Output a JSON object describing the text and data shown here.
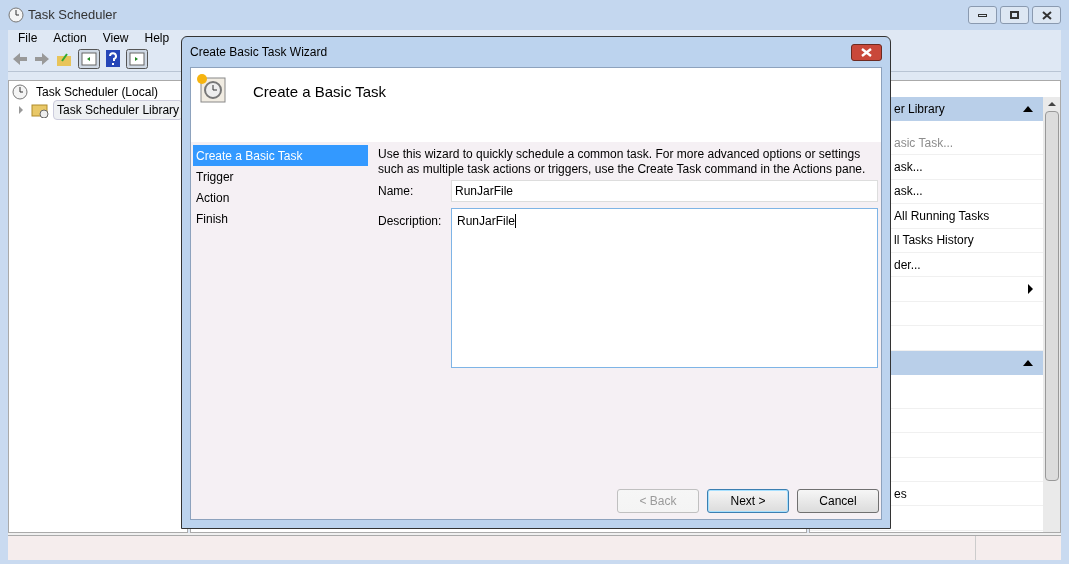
{
  "window": {
    "title": "Task Scheduler"
  },
  "menu": [
    "File",
    "Action",
    "View",
    "Help"
  ],
  "tree": [
    {
      "label": "Task Scheduler (Local)",
      "kind": "root",
      "selected": false
    },
    {
      "label": "Task Scheduler Library",
      "kind": "folder",
      "selected": true
    }
  ],
  "actions_pane": [
    {
      "kind": "header",
      "label": "er Library"
    },
    {
      "kind": "item",
      "label": "asic Task...",
      "disabled": true
    },
    {
      "kind": "item",
      "label": "ask...",
      "disabled": false
    },
    {
      "kind": "item",
      "label": "ask...",
      "disabled": false
    },
    {
      "kind": "item",
      "label": "All Running Tasks",
      "disabled": false
    },
    {
      "kind": "item",
      "label": "ll Tasks History",
      "disabled": false
    },
    {
      "kind": "item",
      "label": "der...",
      "disabled": false
    },
    {
      "kind": "submenu"
    },
    {
      "kind": "blank"
    },
    {
      "kind": "blank"
    },
    {
      "kind": "header"
    },
    {
      "kind": "blank"
    },
    {
      "kind": "blank"
    },
    {
      "kind": "blank"
    },
    {
      "kind": "blank"
    },
    {
      "kind": "item",
      "label": "es",
      "disabled": false
    },
    {
      "kind": "blank"
    }
  ],
  "dialog": {
    "title": "Create Basic Task Wizard",
    "heading": "Create a Basic Task",
    "steps": [
      {
        "label": "Create a Basic Task",
        "selected": true
      },
      {
        "label": "Trigger",
        "selected": false
      },
      {
        "label": "Action",
        "selected": false
      },
      {
        "label": "Finish",
        "selected": false
      }
    ],
    "intro": "Use this wizard to quickly schedule a common task.  For more advanced options or settings such as multiple task actions or triggers, use the Create Task command in the Actions pane.",
    "name": {
      "label": "Name:",
      "value": "RunJarFile"
    },
    "description": {
      "label": "Description:",
      "value": "RunJarFile"
    },
    "buttons": [
      {
        "label": "< Back",
        "disabled": true
      },
      {
        "label": "Next >",
        "disabled": false,
        "default": true
      },
      {
        "label": "Cancel",
        "disabled": false,
        "default": false
      }
    ]
  }
}
